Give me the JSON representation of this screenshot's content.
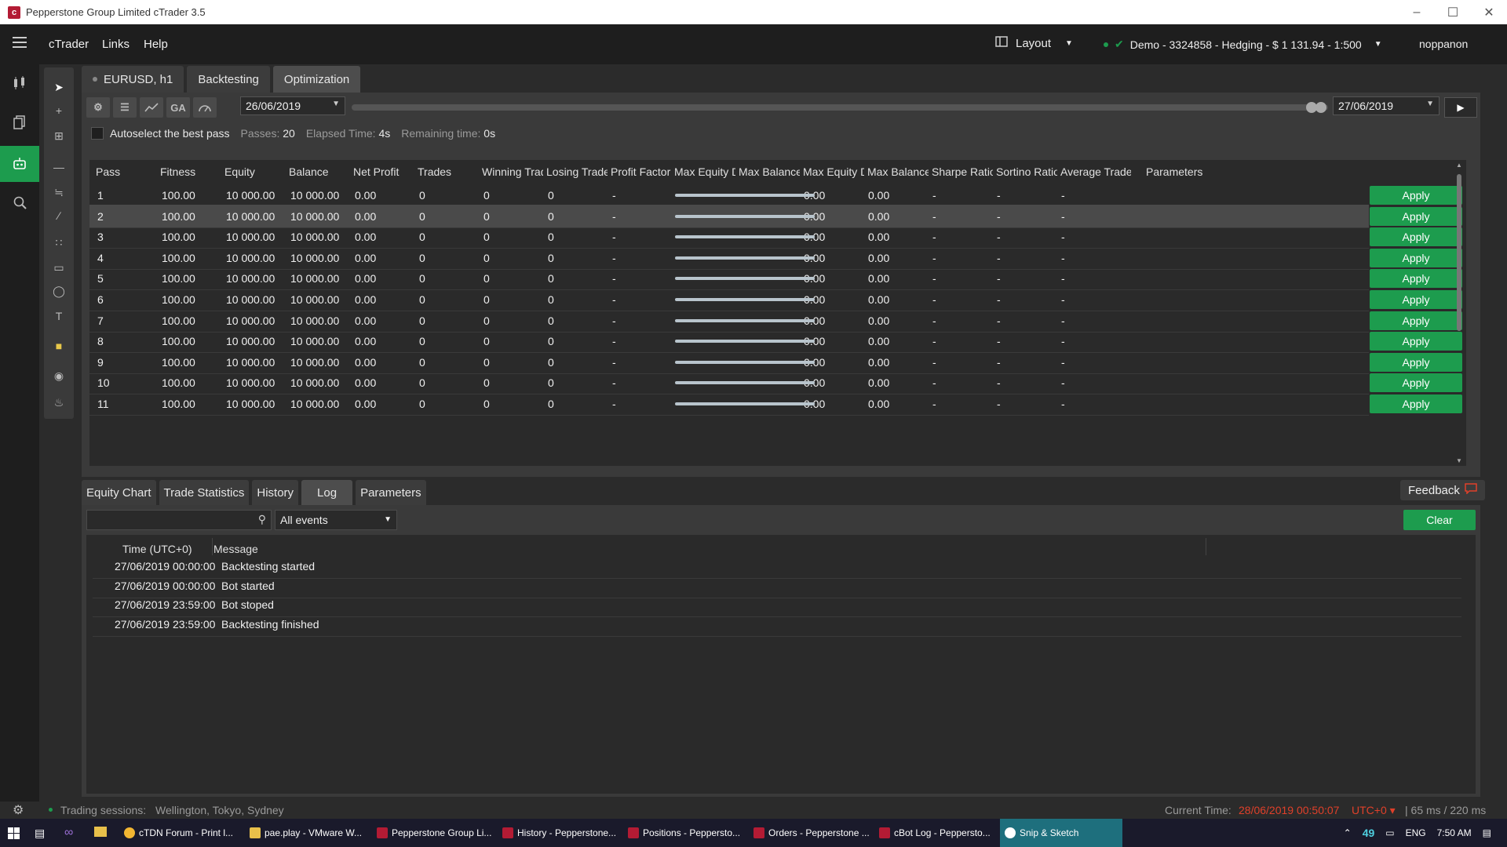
{
  "window": {
    "title": "Pepperstone Group Limited cTrader 3.5"
  },
  "menu": {
    "items": [
      "cTrader",
      "Links",
      "Help"
    ],
    "layout_label": "Layout",
    "account": "Demo  - 3324858 - Hedging - $ 1 131.94 - 1:500",
    "user": "noppanon"
  },
  "tabs": {
    "symbol": "EURUSD, h1",
    "backtesting": "Backtesting",
    "optimization": "Optimization"
  },
  "optimization": {
    "ga_label": "GA",
    "start_date": "26/06/2019",
    "end_date": "27/06/2019",
    "autoselect_label": "Autoselect the best pass",
    "passes_label": "Passes:",
    "passes_value": "20",
    "elapsed_label": "Elapsed Time:",
    "elapsed_value": "4s",
    "remaining_label": "Remaining time:",
    "remaining_value": "0s"
  },
  "results": {
    "columns": [
      "Pass",
      "Fitness",
      "Equity",
      "Balance",
      "Net Profit",
      "Trades",
      "Winning Trades",
      "Losing Trades",
      "Profit Factor",
      "Max Equity D...",
      "Max Balance...",
      "Max Equity D...",
      "Max Balance...",
      "Sharpe Ratio",
      "Sortino Ratio",
      "Average Trade",
      "Parameters"
    ],
    "apply_label": "Apply",
    "selected_row": 2,
    "rows": [
      {
        "pass": "1",
        "fitness": "100.00",
        "equity": "10 000.00",
        "balance": "10 000.00",
        "net_profit": "0.00",
        "trades": "0",
        "winning": "0",
        "losing": "0",
        "profit_factor": "-",
        "max_eq_dd": "0.00",
        "max_bal_dd": "0.00",
        "sharpe": "-",
        "sortino": "-",
        "avg_trade": "-"
      },
      {
        "pass": "2",
        "fitness": "100.00",
        "equity": "10 000.00",
        "balance": "10 000.00",
        "net_profit": "0.00",
        "trades": "0",
        "winning": "0",
        "losing": "0",
        "profit_factor": "-",
        "max_eq_dd": "0.00",
        "max_bal_dd": "0.00",
        "sharpe": "-",
        "sortino": "-",
        "avg_trade": "-"
      },
      {
        "pass": "3",
        "fitness": "100.00",
        "equity": "10 000.00",
        "balance": "10 000.00",
        "net_profit": "0.00",
        "trades": "0",
        "winning": "0",
        "losing": "0",
        "profit_factor": "-",
        "max_eq_dd": "0.00",
        "max_bal_dd": "0.00",
        "sharpe": "-",
        "sortino": "-",
        "avg_trade": "-"
      },
      {
        "pass": "4",
        "fitness": "100.00",
        "equity": "10 000.00",
        "balance": "10 000.00",
        "net_profit": "0.00",
        "trades": "0",
        "winning": "0",
        "losing": "0",
        "profit_factor": "-",
        "max_eq_dd": "0.00",
        "max_bal_dd": "0.00",
        "sharpe": "-",
        "sortino": "-",
        "avg_trade": "-"
      },
      {
        "pass": "5",
        "fitness": "100.00",
        "equity": "10 000.00",
        "balance": "10 000.00",
        "net_profit": "0.00",
        "trades": "0",
        "winning": "0",
        "losing": "0",
        "profit_factor": "-",
        "max_eq_dd": "0.00",
        "max_bal_dd": "0.00",
        "sharpe": "-",
        "sortino": "-",
        "avg_trade": "-"
      },
      {
        "pass": "6",
        "fitness": "100.00",
        "equity": "10 000.00",
        "balance": "10 000.00",
        "net_profit": "0.00",
        "trades": "0",
        "winning": "0",
        "losing": "0",
        "profit_factor": "-",
        "max_eq_dd": "0.00",
        "max_bal_dd": "0.00",
        "sharpe": "-",
        "sortino": "-",
        "avg_trade": "-"
      },
      {
        "pass": "7",
        "fitness": "100.00",
        "equity": "10 000.00",
        "balance": "10 000.00",
        "net_profit": "0.00",
        "trades": "0",
        "winning": "0",
        "losing": "0",
        "profit_factor": "-",
        "max_eq_dd": "0.00",
        "max_bal_dd": "0.00",
        "sharpe": "-",
        "sortino": "-",
        "avg_trade": "-"
      },
      {
        "pass": "8",
        "fitness": "100.00",
        "equity": "10 000.00",
        "balance": "10 000.00",
        "net_profit": "0.00",
        "trades": "0",
        "winning": "0",
        "losing": "0",
        "profit_factor": "-",
        "max_eq_dd": "0.00",
        "max_bal_dd": "0.00",
        "sharpe": "-",
        "sortino": "-",
        "avg_trade": "-"
      },
      {
        "pass": "9",
        "fitness": "100.00",
        "equity": "10 000.00",
        "balance": "10 000.00",
        "net_profit": "0.00",
        "trades": "0",
        "winning": "0",
        "losing": "0",
        "profit_factor": "-",
        "max_eq_dd": "0.00",
        "max_bal_dd": "0.00",
        "sharpe": "-",
        "sortino": "-",
        "avg_trade": "-"
      },
      {
        "pass": "10",
        "fitness": "100.00",
        "equity": "10 000.00",
        "balance": "10 000.00",
        "net_profit": "0.00",
        "trades": "0",
        "winning": "0",
        "losing": "0",
        "profit_factor": "-",
        "max_eq_dd": "0.00",
        "max_bal_dd": "0.00",
        "sharpe": "-",
        "sortino": "-",
        "avg_trade": "-"
      },
      {
        "pass": "11",
        "fitness": "100.00",
        "equity": "10 000.00",
        "balance": "10 000.00",
        "net_profit": "0.00",
        "trades": "0",
        "winning": "0",
        "losing": "0",
        "profit_factor": "-",
        "max_eq_dd": "0.00",
        "max_bal_dd": "0.00",
        "sharpe": "-",
        "sortino": "-",
        "avg_trade": "-"
      }
    ]
  },
  "bottom_tabs": [
    "Equity Chart",
    "Trade Statistics",
    "History",
    "Log",
    "Parameters"
  ],
  "feedback_label": "Feedback",
  "log": {
    "filter_value": "All events",
    "clear_label": "Clear",
    "columns": [
      "Time (UTC+0)",
      "Message"
    ],
    "rows": [
      {
        "time": "27/06/2019 00:00:00",
        "message": "Backtesting started"
      },
      {
        "time": "27/06/2019 00:00:00",
        "message": "Bot started"
      },
      {
        "time": "27/06/2019 23:59:00",
        "message": "Bot stoped"
      },
      {
        "time": "27/06/2019 23:59:00",
        "message": "Backtesting finished"
      }
    ]
  },
  "status": {
    "sessions_label": "Trading sessions:",
    "sessions_value": "Wellington, Tokyo, Sydney",
    "current_time_label": "Current Time:",
    "current_time_value": "28/06/2019 00:50:07",
    "timezone": "UTC+0",
    "latency": "65 ms / 220 ms"
  },
  "taskbar": {
    "tasks": [
      "cTDN Forum - Print l...",
      "pae.play - VMware W...",
      "Pepperstone Group Li...",
      "History - Pepperstone...",
      "Positions - Peppersto...",
      "Orders - Pepperstone ...",
      "cBot Log - Peppersto...",
      "Snip & Sketch"
    ],
    "tray_number": "49",
    "language": "ENG",
    "clock": "7:50 AM"
  },
  "colors": {
    "accent_green": "#1d9c4e",
    "status_time_red": "#e0402a",
    "panel": "#3a3a3a",
    "table_bg": "#2a2a2a"
  }
}
